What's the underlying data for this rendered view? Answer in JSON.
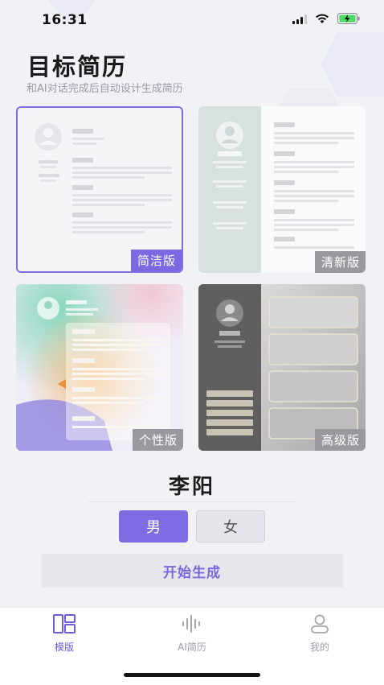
{
  "status": {
    "time": "16:31"
  },
  "header": {
    "title": "目标简历",
    "subtitle": "和AI对话完成后自动设计生成简历"
  },
  "templates": [
    {
      "label": "简洁版",
      "selected": true
    },
    {
      "label": "清新版",
      "selected": false
    },
    {
      "label": "个性版",
      "selected": false
    },
    {
      "label": "高级版",
      "selected": false
    }
  ],
  "form": {
    "name": "李阳",
    "gender_options": [
      "男",
      "女"
    ],
    "gender_selected": "男",
    "generate_label": "开始生成"
  },
  "tabbar": {
    "items": [
      {
        "label": "模版",
        "icon": "template-icon",
        "active": true
      },
      {
        "label": "AI简历",
        "icon": "voice-wave-icon",
        "active": false
      },
      {
        "label": "我的",
        "icon": "user-icon",
        "active": false
      }
    ]
  },
  "colors": {
    "accent": "#7d68e3",
    "badge_inactive": "#9a9a9e",
    "background": "#f1f1f6"
  }
}
